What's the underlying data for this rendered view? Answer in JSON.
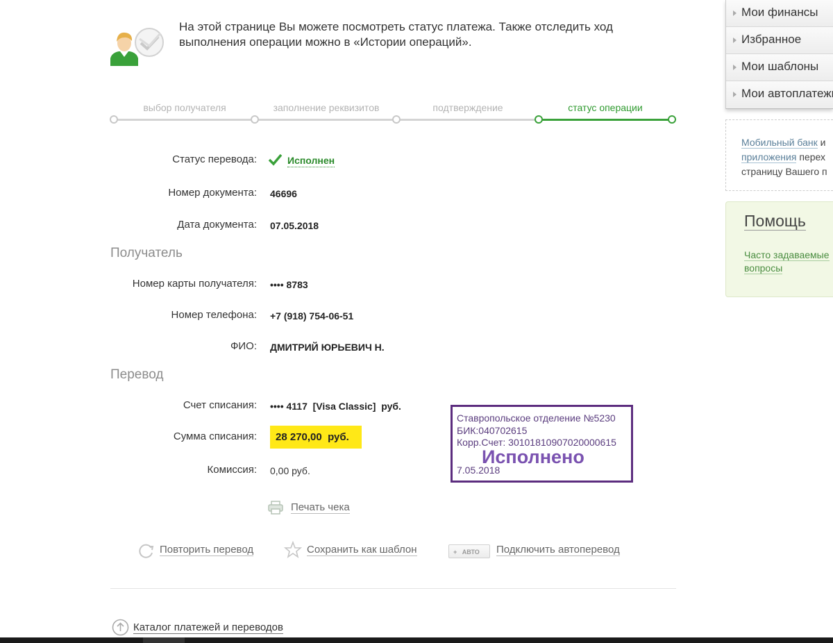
{
  "intro": {
    "text": "На этой странице Вы можете посмотреть статус платежа. Также отследить ход выполнения операции можно в «Истории операций»."
  },
  "steps": [
    {
      "label": "выбор получателя",
      "active": false
    },
    {
      "label": "заполнение реквизитов",
      "active": false
    },
    {
      "label": "подтверждение",
      "active": false
    },
    {
      "label": "статус операции",
      "active": true
    }
  ],
  "transfer_status": {
    "label": "Статус перевода:",
    "value": "Исполнен"
  },
  "document": {
    "number_label": "Номер документа:",
    "number": "46696",
    "date_label": "Дата документа:",
    "date": "07.05.2018"
  },
  "recipient": {
    "section_title": "Получатель",
    "card_label": "Номер карты получателя:",
    "card": "•••• 8783",
    "phone_label": "Номер телефона:",
    "phone": "+7 (918) 754-06-51",
    "name_label": "ФИО:",
    "name": "ДМИТРИЙ ЮРЬЕВИЧ Н."
  },
  "transfer": {
    "section_title": "Перевод",
    "account_label": "Счет списания:",
    "account": "•••• 4117  [Visa Classic]  руб.",
    "amount_label": "Сумма списания:",
    "amount": "28 270,00  руб.",
    "fee_label": "Комиссия:",
    "fee": "0,00 руб."
  },
  "stamp": {
    "branch": "Ставропольское отделение №5230",
    "bik": "БИК:040702615",
    "corr": "Корр.Счет: 30101810907020000615",
    "status": "Исполнено",
    "date": "7.05.2018"
  },
  "actions": {
    "print_receipt": "Печать чека",
    "repeat": "Повторить перевод",
    "save_template": "Сохранить как шаблон",
    "auto_badge_plus": "+",
    "auto_badge": "АВТО",
    "auto_transfer": "Подключить автоперевод",
    "catalog": "Каталог платежей и переводов"
  },
  "sidebar": {
    "menu": [
      {
        "label": "Мои финансы"
      },
      {
        "label": "Избранное"
      },
      {
        "label": "Мои шаблоны"
      },
      {
        "label": "Мои автоплатежи"
      }
    ],
    "mobile": {
      "link1": "Мобильный банк",
      "text1": " и",
      "link2": "приложения",
      "text2": " перех",
      "text3": "страницу Вашего п"
    },
    "help": {
      "title": "Помощь",
      "faq_line1": "Часто задаваемые",
      "faq_line2": "вопросы"
    }
  },
  "colors": {
    "accent_green": "#3aa13a",
    "highlight_yellow": "#ffe817",
    "stamp_purple": "#5c2d7f"
  }
}
